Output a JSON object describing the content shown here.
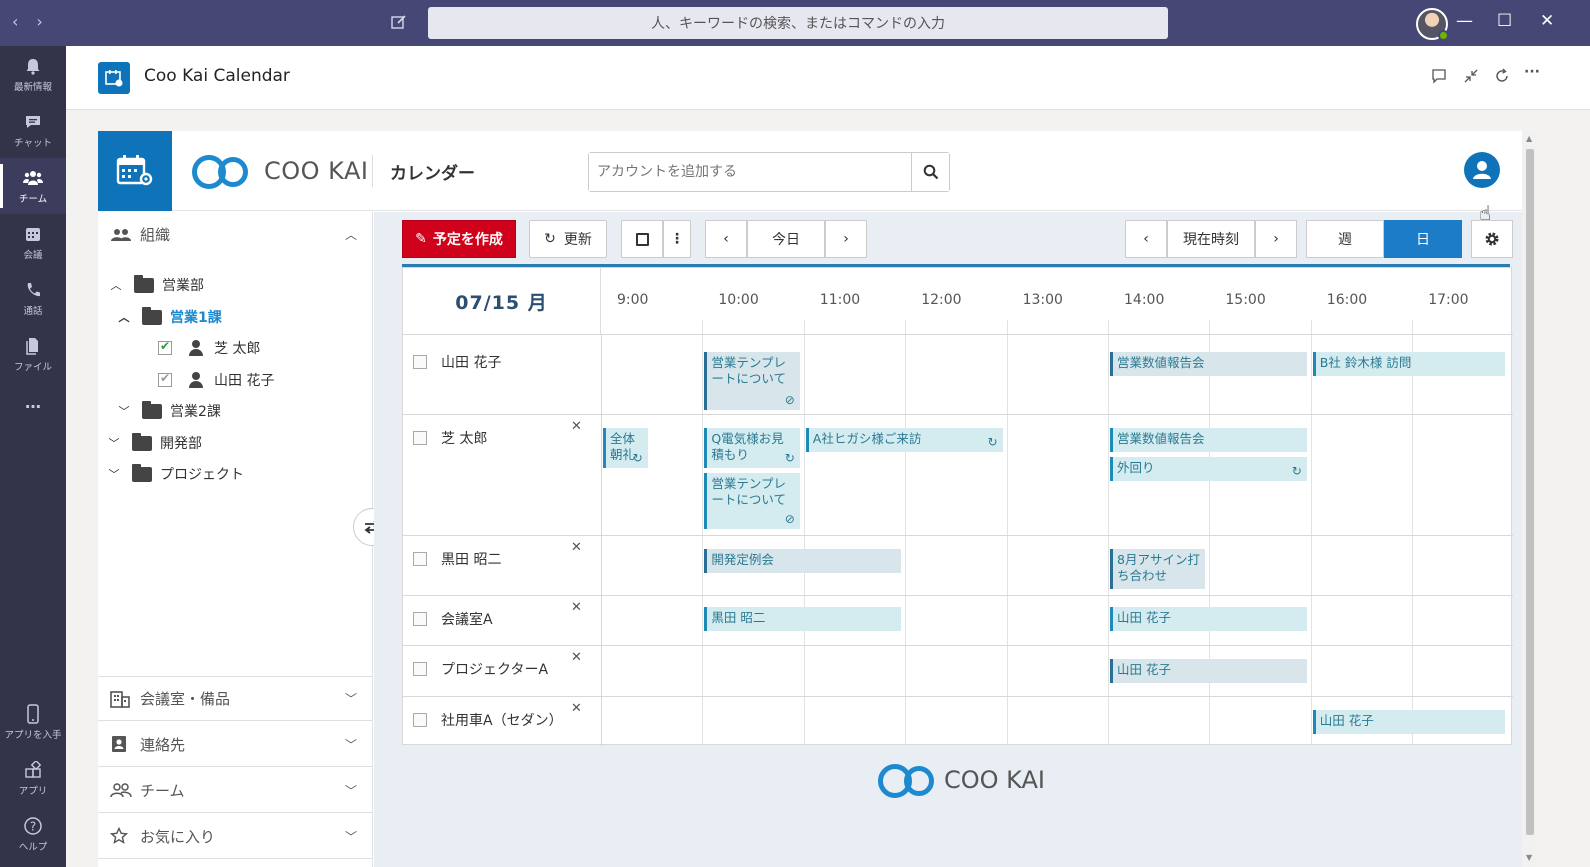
{
  "titlebar": {
    "search_placeholder": "人、キーワードの検索、またはコマンドの入力",
    "back": "‹",
    "forward": "›",
    "minimize": "—",
    "maximize": "☐",
    "close": "✕"
  },
  "rail": {
    "items": [
      {
        "label": "最新情報",
        "icon": "bell-icon"
      },
      {
        "label": "チャット",
        "icon": "chat-icon"
      },
      {
        "label": "チーム",
        "icon": "teams-icon",
        "active": true
      },
      {
        "label": "会議",
        "icon": "calendar-icon"
      },
      {
        "label": "通話",
        "icon": "phone-icon"
      },
      {
        "label": "ファイル",
        "icon": "file-icon"
      },
      {
        "label": "…",
        "icon": "more-icon"
      },
      {
        "label": "アプリを入手",
        "icon": "mobile-icon"
      },
      {
        "label": "アプリ",
        "icon": "apps-icon"
      },
      {
        "label": "ヘルプ",
        "icon": "help-icon"
      }
    ]
  },
  "app": {
    "title": "Coo Kai Calendar"
  },
  "cookai": {
    "logo_text": "COO KAI",
    "page_title": "カレンダー",
    "account_placeholder": "アカウントを追加する"
  },
  "sidebar": {
    "org_label": "組織",
    "tree": [
      {
        "label": "営業部",
        "type": "folder"
      },
      {
        "label": "営業1課",
        "type": "folder",
        "selected": true
      },
      {
        "label": "芝 太郎",
        "type": "person",
        "checked": true
      },
      {
        "label": "山田 花子",
        "type": "person",
        "checked": true
      },
      {
        "label": "営業2課",
        "type": "folder"
      },
      {
        "label": "開発部",
        "type": "folder"
      },
      {
        "label": "プロジェクト",
        "type": "folder"
      }
    ],
    "sections": [
      "会議室・備品",
      "連絡先",
      "チーム",
      "お気に入り"
    ]
  },
  "toolbar": {
    "create": "予定を作成",
    "refresh": "更新",
    "today": "今日",
    "now": "現在時刻",
    "week": "週",
    "day": "日"
  },
  "calendar": {
    "date": "07/15 月",
    "hours": [
      "9:00",
      "10:00",
      "11:00",
      "12:00",
      "13:00",
      "14:00",
      "15:00",
      "16:00",
      "17:00"
    ],
    "rows": [
      {
        "name": "山田 花子",
        "closable": false
      },
      {
        "name": "芝 太郎",
        "closable": true
      },
      {
        "name": "黒田 昭二",
        "closable": true
      },
      {
        "name": "会議室A",
        "closable": true
      },
      {
        "name": "プロジェクターA",
        "closable": true
      },
      {
        "name": "社用車A（セダン）",
        "closable": true
      }
    ],
    "events": [
      {
        "row": 0,
        "title": "営業テンプレートについて",
        "start": "10:00",
        "end": "11:00"
      },
      {
        "row": 0,
        "title": "営業数値報告会",
        "start": "14:00",
        "end": "16:00"
      },
      {
        "row": 0,
        "title": "B社 鈴木様 訪問",
        "start": "16:00",
        "end": "18:00"
      },
      {
        "row": 1,
        "title": "全体朝礼",
        "start": "9:00",
        "end": "9:30"
      },
      {
        "row": 1,
        "title": "Q電気様お見積もり",
        "start": "10:00",
        "end": "11:00"
      },
      {
        "row": 1,
        "title": "A社ヒガシ様ご来訪",
        "start": "11:00",
        "end": "13:00"
      },
      {
        "row": 1,
        "title": "営業数値報告会",
        "start": "14:00",
        "end": "16:00"
      },
      {
        "row": 1,
        "title": "外回り",
        "start": "14:00",
        "end": "16:00"
      },
      {
        "row": 1,
        "title": "営業テンプレートについて",
        "start": "10:00",
        "end": "11:00"
      },
      {
        "row": 2,
        "title": "開発定例会",
        "start": "10:00",
        "end": "12:00"
      },
      {
        "row": 2,
        "title": "8月アサイン打ち合わせ",
        "start": "14:00",
        "end": "15:00"
      },
      {
        "row": 3,
        "title": "黒田 昭二",
        "start": "10:00",
        "end": "12:00"
      },
      {
        "row": 3,
        "title": "山田 花子",
        "start": "14:00",
        "end": "16:00"
      },
      {
        "row": 4,
        "title": "山田 花子",
        "start": "14:00",
        "end": "16:00"
      },
      {
        "row": 5,
        "title": "山田 花子",
        "start": "16:00",
        "end": "18:00"
      }
    ]
  },
  "footer": {
    "logo_text": "COO KAI"
  },
  "colors": {
    "teams_titlebar": "#464775",
    "teams_rail": "#33344a",
    "brand_blue": "#0f73b9",
    "create_red": "#d0021b",
    "event_bg": "#d4ebf0"
  }
}
